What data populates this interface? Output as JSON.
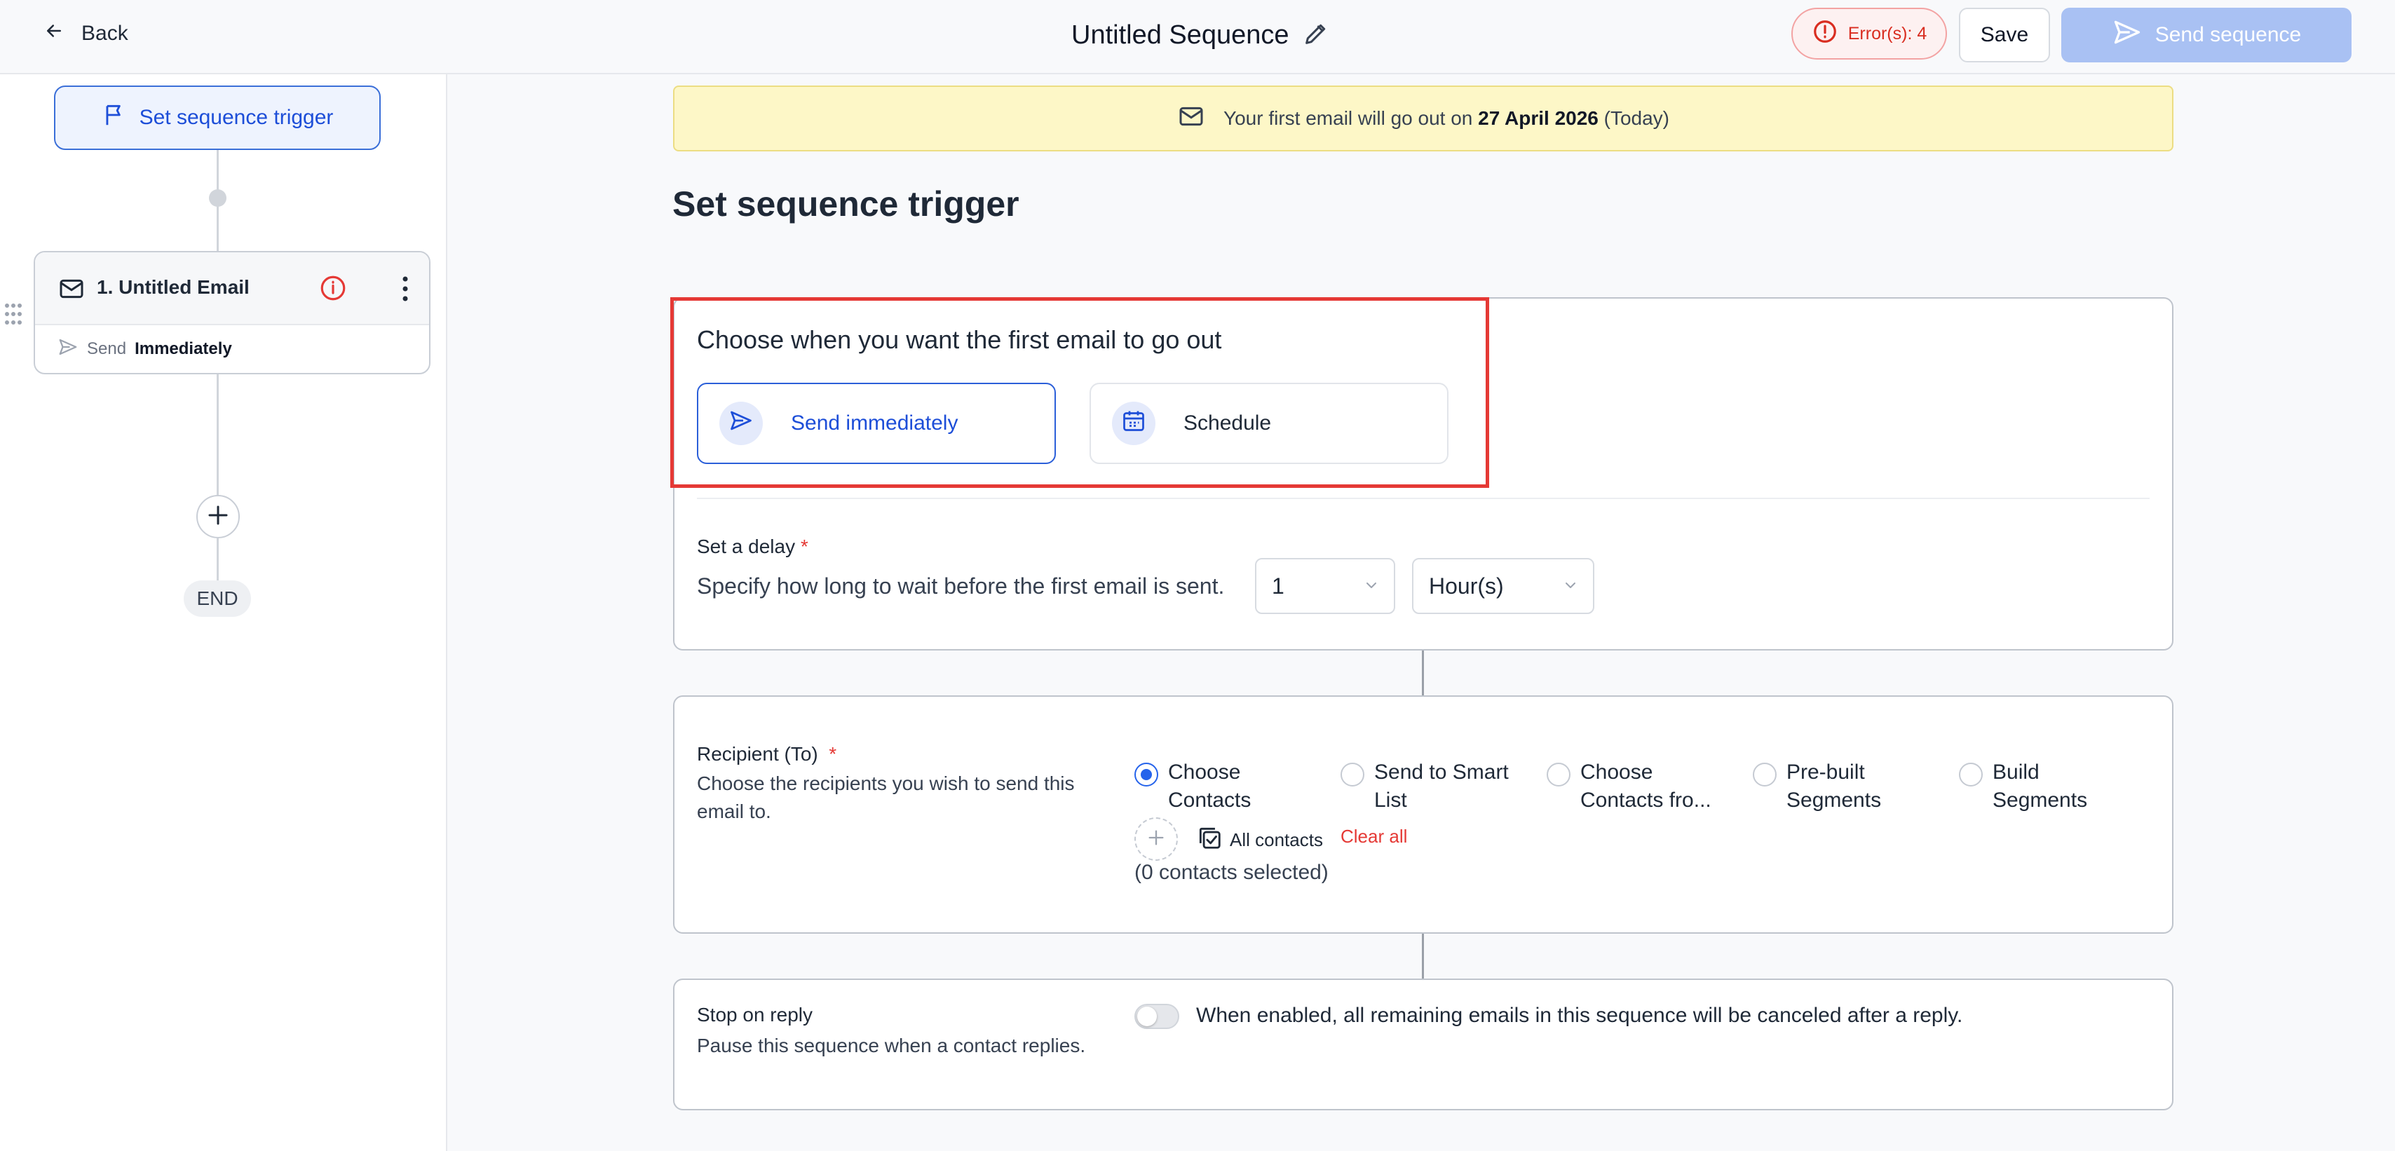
{
  "header": {
    "back_label": "Back",
    "title": "Untitled Sequence",
    "errors_label": "Error(s): 4",
    "save_label": "Save",
    "send_label": "Send sequence"
  },
  "sidebar": {
    "trigger_label": "Set sequence trigger",
    "email_name": "1. Untitled Email",
    "send_prefix": "Send",
    "send_timing": "Immediately",
    "end_label": "END"
  },
  "banner": {
    "text_before": "Your first email will go out on",
    "date": "27 April 2026",
    "text_after": "(Today)"
  },
  "main": {
    "title": "Set sequence trigger",
    "choose_title": "Choose when you want the first email to go out",
    "option_immediate": "Send immediately",
    "option_schedule": "Schedule",
    "delay_label": "Set a delay",
    "required_mark": "*",
    "delay_desc": "Specify how long to wait before the first email is sent.",
    "delay_value": "1",
    "delay_unit": "Hour(s)"
  },
  "recipient": {
    "label": "Recipient (To)",
    "desc": "Choose the recipients you wish to send this email to.",
    "options": [
      {
        "line1": "Choose",
        "line2": "Contacts",
        "selected": true
      },
      {
        "line1": "Send to Smart",
        "line2": "List",
        "selected": false
      },
      {
        "line1": "Choose",
        "line2": "Contacts fro...",
        "selected": false
      },
      {
        "line1": "Pre-built",
        "line2": "Segments",
        "selected": false
      },
      {
        "line1": "Build",
        "line2": "Segments",
        "selected": false
      }
    ],
    "all_contacts": "All contacts",
    "clear_all": "Clear all",
    "selected_count": "(0 contacts selected)"
  },
  "stop_on_reply": {
    "label": "Stop on reply",
    "desc": "Pause this sequence when a contact replies.",
    "toggle_text": "When enabled, all remaining emails in this sequence will be canceled after a reply.",
    "enabled": false
  },
  "colors": {
    "accent": "#2563eb",
    "error": "#d92d20",
    "banner_bg": "#fdf7c7",
    "highlight_border": "#e53935"
  }
}
